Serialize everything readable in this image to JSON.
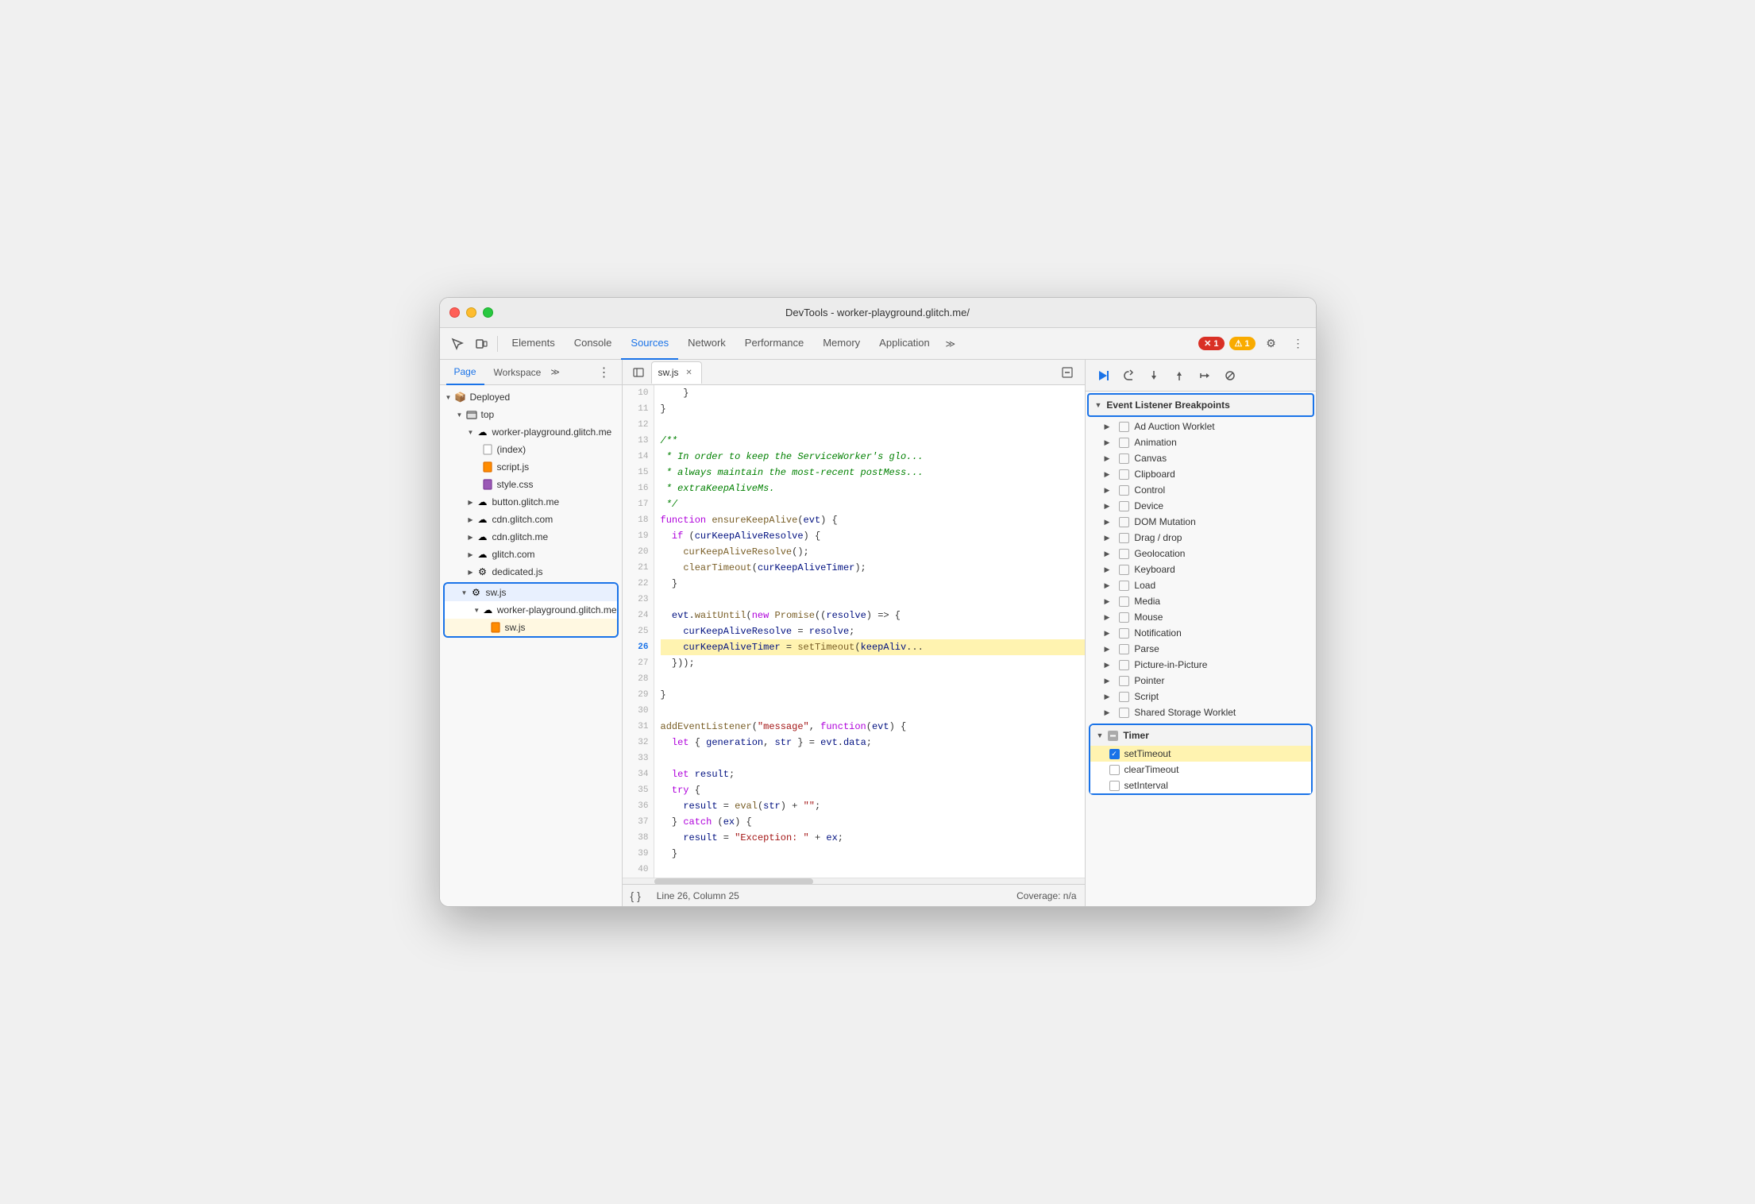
{
  "window": {
    "title": "DevTools - worker-playground.glitch.me/"
  },
  "toolbar": {
    "tabs": [
      {
        "id": "elements",
        "label": "Elements",
        "active": false
      },
      {
        "id": "console",
        "label": "Console",
        "active": false
      },
      {
        "id": "sources",
        "label": "Sources",
        "active": true
      },
      {
        "id": "network",
        "label": "Network",
        "active": false
      },
      {
        "id": "performance",
        "label": "Performance",
        "active": false
      },
      {
        "id": "memory",
        "label": "Memory",
        "active": false
      },
      {
        "id": "application",
        "label": "Application",
        "active": false
      }
    ],
    "error_count": "1",
    "warning_count": "1"
  },
  "file_panel": {
    "tabs": [
      "Page",
      "Workspace"
    ],
    "tree": {
      "items": [
        {
          "label": "Deployed",
          "indent": 0,
          "type": "folder",
          "expanded": true
        },
        {
          "label": "top",
          "indent": 1,
          "type": "folder",
          "expanded": true
        },
        {
          "label": "worker-playground.glitch.me",
          "indent": 2,
          "type": "cloud",
          "expanded": true
        },
        {
          "label": "(index)",
          "indent": 3,
          "type": "file-white"
        },
        {
          "label": "script.js",
          "indent": 3,
          "type": "file-orange"
        },
        {
          "label": "style.css",
          "indent": 3,
          "type": "file-purple"
        },
        {
          "label": "button.glitch.me",
          "indent": 2,
          "type": "cloud",
          "expanded": false
        },
        {
          "label": "cdn.glitch.com",
          "indent": 2,
          "type": "cloud",
          "expanded": false
        },
        {
          "label": "cdn.glitch.me",
          "indent": 2,
          "type": "cloud",
          "expanded": false
        },
        {
          "label": "glitch.com",
          "indent": 2,
          "type": "cloud",
          "expanded": false
        },
        {
          "label": "dedicated.js",
          "indent": 2,
          "type": "gear"
        }
      ]
    },
    "selected_group": {
      "root": {
        "label": "sw.js",
        "indent": 1,
        "type": "gear",
        "selected": true
      },
      "sub": {
        "label": "worker-playground.glitch.me",
        "indent": 2,
        "type": "cloud"
      },
      "file": {
        "label": "sw.js",
        "indent": 3,
        "type": "file-orange"
      }
    }
  },
  "code_panel": {
    "tab_label": "sw.js",
    "lines": [
      {
        "num": 10,
        "code": "    }",
        "highlight": false
      },
      {
        "num": 11,
        "code": "}",
        "highlight": false
      },
      {
        "num": 12,
        "code": "",
        "highlight": false
      },
      {
        "num": 13,
        "code": "/**",
        "highlight": false,
        "type": "comment"
      },
      {
        "num": 14,
        "code": " * In order to keep the ServiceWorker's glo...",
        "highlight": false,
        "type": "comment"
      },
      {
        "num": 15,
        "code": " * always maintain the most-recent postMess...",
        "highlight": false,
        "type": "comment"
      },
      {
        "num": 16,
        "code": " * extraKeepAliveMs.",
        "highlight": false,
        "type": "comment"
      },
      {
        "num": 17,
        "code": " */",
        "highlight": false,
        "type": "comment"
      },
      {
        "num": 18,
        "code": "function ensureKeepAlive(evt) {",
        "highlight": false
      },
      {
        "num": 19,
        "code": "  if (curKeepAliveResolve) {",
        "highlight": false
      },
      {
        "num": 20,
        "code": "    curKeepAliveResolve();",
        "highlight": false
      },
      {
        "num": 21,
        "code": "    clearTimeout(curKeepAliveTimer);",
        "highlight": false
      },
      {
        "num": 22,
        "code": "  }",
        "highlight": false
      },
      {
        "num": 23,
        "code": "",
        "highlight": false
      },
      {
        "num": 24,
        "code": "  evt.waitUntil(new Promise((resolve) => {",
        "highlight": false
      },
      {
        "num": 25,
        "code": "    curKeepAliveResolve = resolve;",
        "highlight": false
      },
      {
        "num": 26,
        "code": "    curKeepAliveTimer = setTimeout(keepAliv...",
        "highlight": true
      },
      {
        "num": 27,
        "code": "  }));",
        "highlight": false
      },
      {
        "num": 28,
        "code": "",
        "highlight": false
      },
      {
        "num": 29,
        "code": "}",
        "highlight": false
      },
      {
        "num": 30,
        "code": "",
        "highlight": false
      },
      {
        "num": 31,
        "code": "addEventListener(\"message\", function(evt) {",
        "highlight": false
      },
      {
        "num": 32,
        "code": "  let { generation, str } = evt.data;",
        "highlight": false
      },
      {
        "num": 33,
        "code": "",
        "highlight": false
      },
      {
        "num": 34,
        "code": "  let result;",
        "highlight": false
      },
      {
        "num": 35,
        "code": "  try {",
        "highlight": false
      },
      {
        "num": 36,
        "code": "    result = eval(str) + \"\";",
        "highlight": false
      },
      {
        "num": 37,
        "code": "  } catch (ex) {",
        "highlight": false
      },
      {
        "num": 38,
        "code": "    result = \"Exception: \" + ex;",
        "highlight": false
      },
      {
        "num": 39,
        "code": "  }",
        "highlight": false
      },
      {
        "num": 40,
        "code": "",
        "highlight": false
      }
    ],
    "footer": {
      "position": "Line 26, Column 25",
      "coverage": "Coverage: n/a",
      "format_label": "{ }"
    }
  },
  "breakpoints": {
    "debug_tools": [
      "resume",
      "step-over",
      "step-into",
      "step-out",
      "deactivate"
    ],
    "section_title": "Event Listener Breakpoints",
    "items": [
      {
        "label": "Ad Auction Worklet",
        "checked": false,
        "expanded": false
      },
      {
        "label": "Animation",
        "checked": false,
        "expanded": false
      },
      {
        "label": "Canvas",
        "checked": false,
        "expanded": false
      },
      {
        "label": "Clipboard",
        "checked": false,
        "expanded": false
      },
      {
        "label": "Control",
        "checked": false,
        "expanded": false
      },
      {
        "label": "Device",
        "checked": false,
        "expanded": false
      },
      {
        "label": "DOM Mutation",
        "checked": false,
        "expanded": false
      },
      {
        "label": "Drag / drop",
        "checked": false,
        "expanded": false
      },
      {
        "label": "Geolocation",
        "checked": false,
        "expanded": false
      },
      {
        "label": "Keyboard",
        "checked": false,
        "expanded": false
      },
      {
        "label": "Load",
        "checked": false,
        "expanded": false
      },
      {
        "label": "Media",
        "checked": false,
        "expanded": false
      },
      {
        "label": "Mouse",
        "checked": false,
        "expanded": false
      },
      {
        "label": "Notification",
        "checked": false,
        "expanded": false
      },
      {
        "label": "Parse",
        "checked": false,
        "expanded": false
      },
      {
        "label": "Picture-in-Picture",
        "checked": false,
        "expanded": false
      },
      {
        "label": "Pointer",
        "checked": false,
        "expanded": false
      },
      {
        "label": "Script",
        "checked": false,
        "expanded": false
      },
      {
        "label": "Shared Storage Worklet",
        "checked": false,
        "expanded": false
      }
    ],
    "timer_section": {
      "label": "Timer",
      "expanded": true,
      "items": [
        {
          "label": "setTimeout",
          "checked": true,
          "highlight": true
        },
        {
          "label": "clearTimeout",
          "checked": false
        },
        {
          "label": "setInterval",
          "checked": false
        }
      ]
    }
  },
  "colors": {
    "accent_blue": "#1a73e8",
    "error_red": "#d93025",
    "warning_yellow": "#f9ab00",
    "highlight_yellow": "#fff3b0",
    "code_comment": "#008000",
    "code_keyword": "#af00db",
    "code_string": "#a31515",
    "code_function": "#795e26"
  }
}
